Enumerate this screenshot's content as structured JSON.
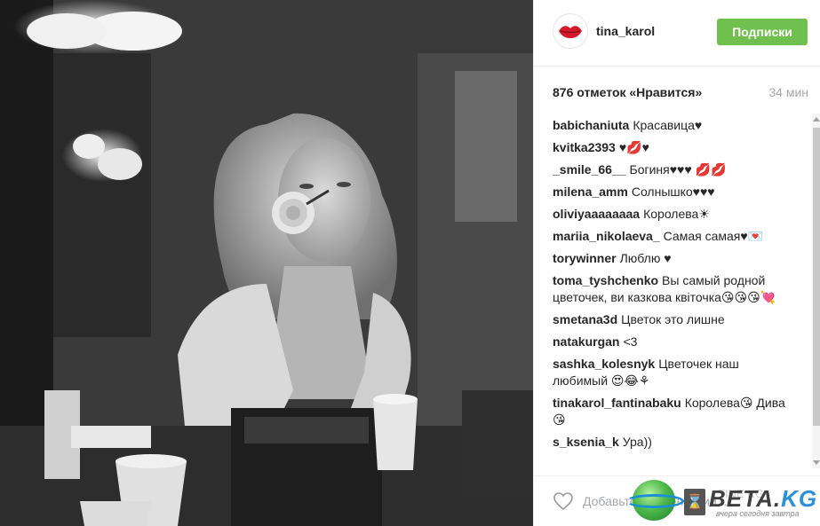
{
  "post": {
    "image_alt": "Black and white photo of a woman holding a rose in her mouth"
  },
  "header": {
    "username": "tina_karol",
    "follow_label": "Подписки",
    "avatar_icon": "lips-icon"
  },
  "stats": {
    "likes_text": "876 отметок «Нравится»",
    "time_ago": "34 мин"
  },
  "comments": [
    {
      "author": "babichaniuta",
      "text": "Красавица♥"
    },
    {
      "author": "kvitka2393",
      "text": "♥💋♥"
    },
    {
      "author": "_smile_66__",
      "text": "Богиня♥♥♥ 💋💋"
    },
    {
      "author": "milena_amm",
      "text": "Солнышко♥♥♥"
    },
    {
      "author": "oliviyaaaaaaaa",
      "text": "Королева☀"
    },
    {
      "author": "mariia_nikolaeva_",
      "text": "Самая самая♥💌"
    },
    {
      "author": "torywinner",
      "text": "Люблю ♥"
    },
    {
      "author": "toma_tyshchenko",
      "text": "Вы самый родной цветочек, ви казкова квіточка😘😘😘💘"
    },
    {
      "author": "smetana3d",
      "text": "Цветок это лишне"
    },
    {
      "author": "natakurgan",
      "text": "<3"
    },
    {
      "author": "sashka_kolesnyk",
      "text": "Цветочек наш любимый 😍😂⚘"
    },
    {
      "author": "tinakarol_fantinabaku",
      "text": "Королева😘 Дива😘"
    },
    {
      "author": "s_ksenia_k",
      "text": "Ура))"
    }
  ],
  "footer": {
    "comment_placeholder": "Добавьте комментарий...",
    "like_icon": "heart-outline-icon"
  },
  "watermark": {
    "brand_main": "BETA.",
    "brand_suffix": "KG",
    "tagline": "вчера сегодня завтра",
    "faint_text": "TINE KG"
  },
  "colors": {
    "follow_button": "#70c050",
    "text": "#262626",
    "muted": "#a5a7aa",
    "brand_blue": "#2b8fd9"
  }
}
